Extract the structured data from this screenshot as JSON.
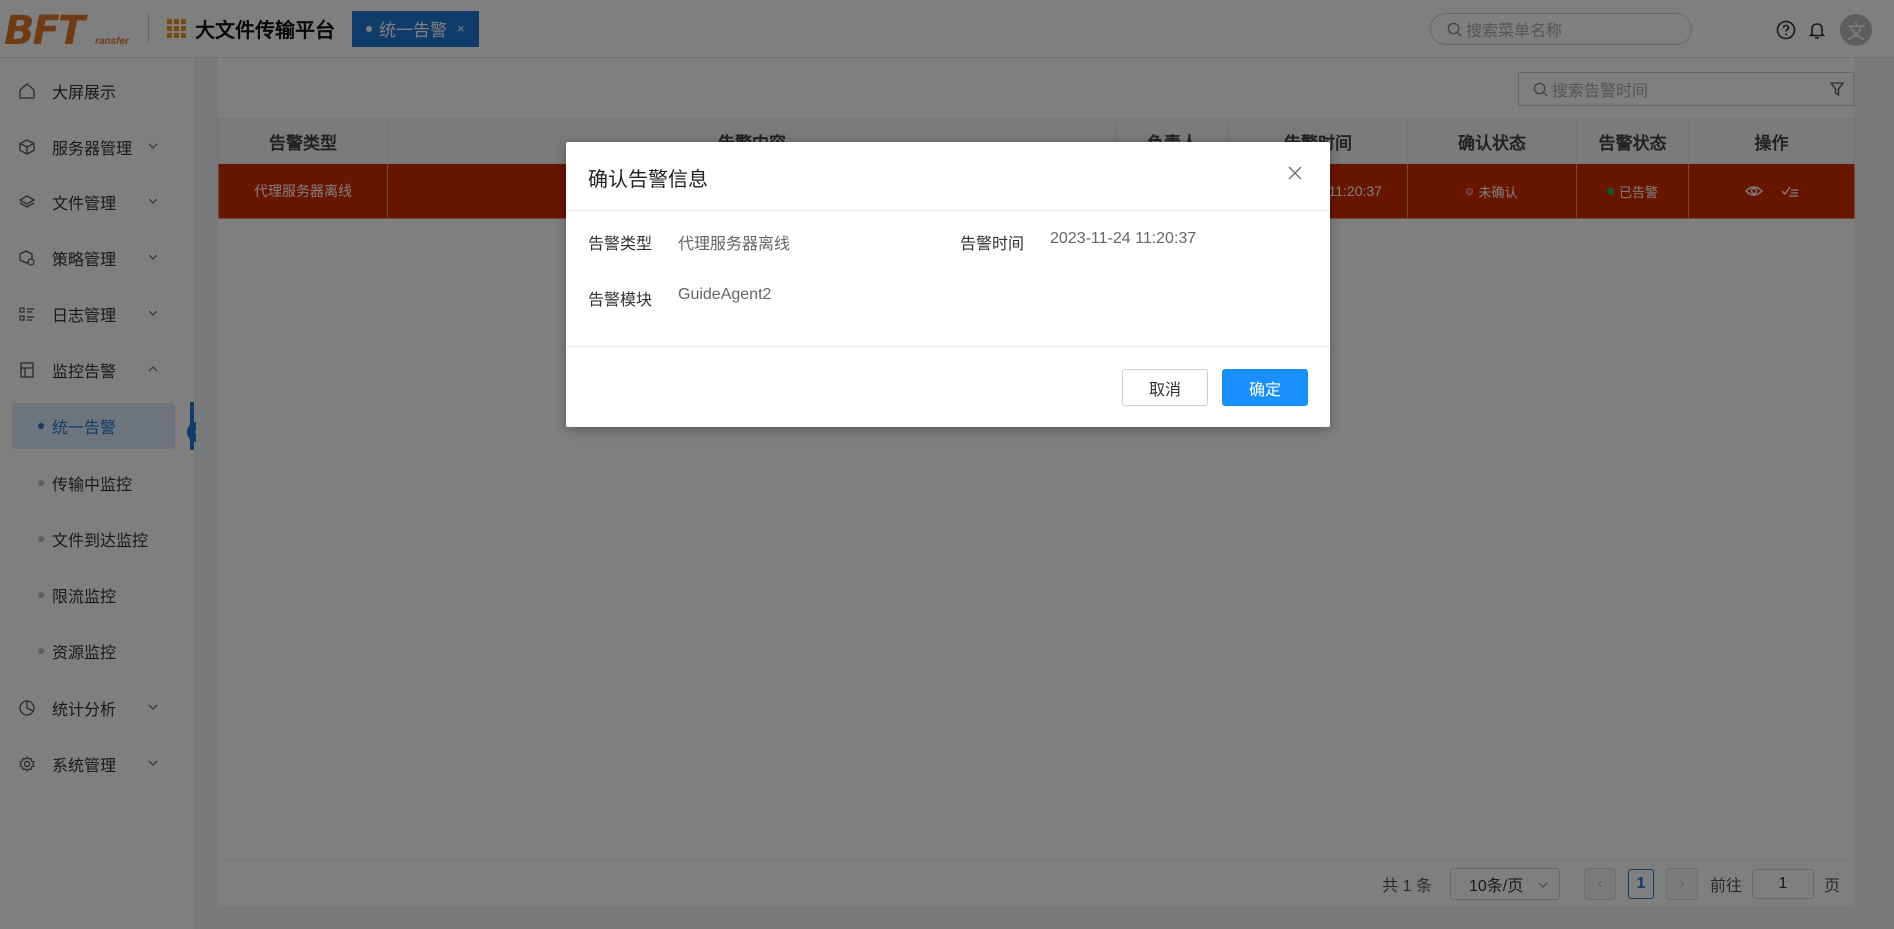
{
  "header": {
    "logo_big": "BFT",
    "logo_small": "ransfer",
    "app_title": "大文件传输平台",
    "active_tab": "统一告警",
    "tab_close": "×",
    "menu_search_placeholder": "搜索菜单名称",
    "avatar_text": "文"
  },
  "sidebar": {
    "items": [
      {
        "label": "大屏展示"
      },
      {
        "label": "服务器管理"
      },
      {
        "label": "文件管理"
      },
      {
        "label": "策略管理"
      },
      {
        "label": "日志管理"
      },
      {
        "label": "监控告警"
      },
      {
        "label": "统计分析"
      },
      {
        "label": "系统管理"
      }
    ],
    "sub_items": [
      {
        "label": "统一告警"
      },
      {
        "label": "传输中监控"
      },
      {
        "label": "文件到达监控"
      },
      {
        "label": "限流监控"
      },
      {
        "label": "资源监控"
      }
    ]
  },
  "main": {
    "alarm_search_placeholder": "搜索告警时间",
    "table": {
      "headers": [
        "告警类型",
        "告警内容",
        "负责人",
        "告警时间",
        "确认状态",
        "告警状态",
        "操作"
      ],
      "rows": [
        {
          "type": "代理服务器离线",
          "content": "",
          "owner": "",
          "time": "2023-11-24 11:20:37",
          "confirm": "未确认",
          "status": "已告警"
        }
      ]
    },
    "pager": {
      "total": "共 1 条",
      "page_size": "10条/页",
      "current": "1",
      "goto_prefix": "前往",
      "goto_value": "1",
      "goto_suffix": "页"
    }
  },
  "modal": {
    "title": "确认告警信息",
    "type_label": "告警类型",
    "type_value": "代理服务器离线",
    "time_label": "告警时间",
    "time_value": "2023-11-24 11:20:37",
    "module_label": "告警模块",
    "module_value": "GuideAgent2",
    "cancel": "取消",
    "ok": "确定"
  },
  "colors": {
    "primary": "#1e78d4",
    "alarm_row": "#d32c00",
    "ok_button": "#1890ff",
    "unconfirmed_dot": "#e74c3c",
    "alarmed_dot": "#27ae60"
  }
}
